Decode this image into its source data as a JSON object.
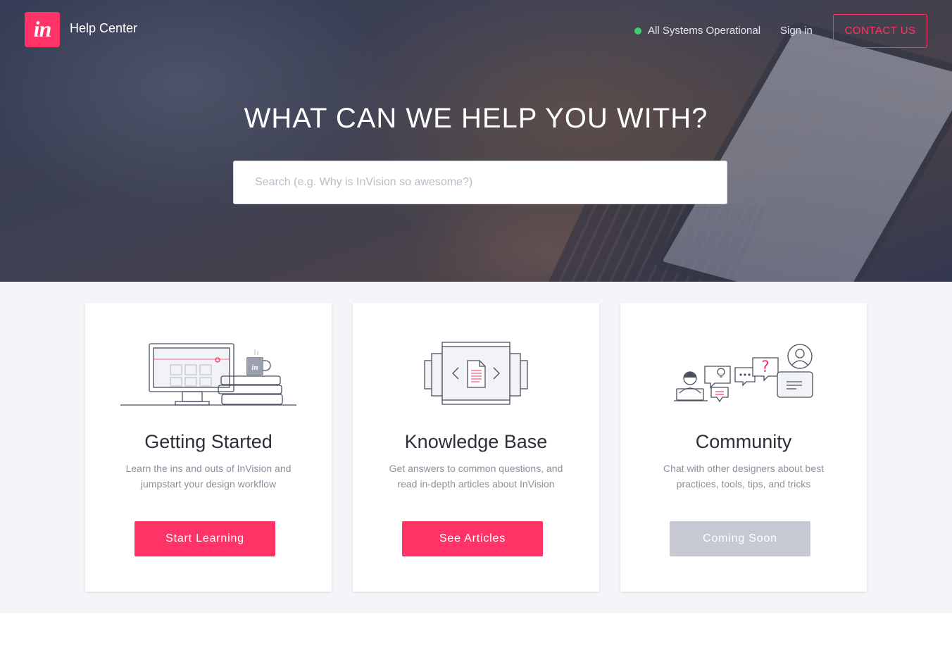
{
  "header": {
    "logo_text": "in",
    "brand_title": "Help Center",
    "status_text": "All Systems Operational",
    "signin_label": "Sign in",
    "contact_label": "CONTACT US"
  },
  "hero": {
    "title": "WHAT CAN WE HELP YOU WITH?",
    "search_placeholder": "Search (e.g. Why is InVision so awesome?)"
  },
  "cards": [
    {
      "title": "Getting Started",
      "description": "Learn the ins and outs of InVision and jumpstart your design workflow",
      "button_label": "Start Learning",
      "button_state": "active"
    },
    {
      "title": "Knowledge Base",
      "description": "Get answers to common questions, and read in-depth articles about InVision",
      "button_label": "See Articles",
      "button_state": "active"
    },
    {
      "title": "Community",
      "description": "Chat with other designers about best practices, tools, tips, and tricks",
      "button_label": "Coming Soon",
      "button_state": "disabled"
    }
  ],
  "colors": {
    "brand": "#ff3366",
    "status_green": "#3ccf6e",
    "disabled_button": "#c6c9d4",
    "section_bg": "#f4f5f8"
  },
  "icons": [
    "invision-logo",
    "status-dot-icon",
    "desktop-coffee-illustration",
    "document-carousel-illustration",
    "community-chat-illustration"
  ]
}
